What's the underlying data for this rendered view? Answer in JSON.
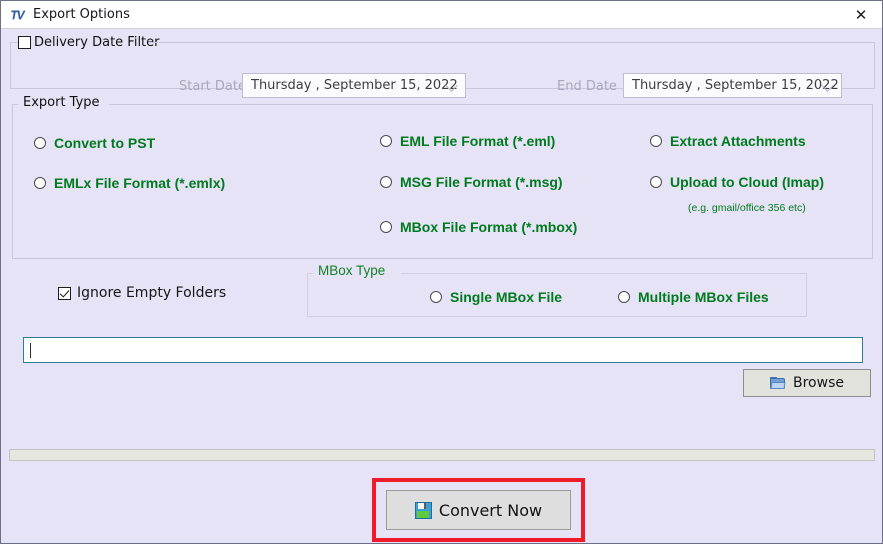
{
  "window": {
    "title": "Export Options",
    "app_icon": "tv-logo-icon",
    "close_label": "✕"
  },
  "delivery_filter": {
    "label": "Delivery Date Filter",
    "checked": false,
    "start": {
      "label": "Start Date",
      "value": "Thursday  , September 15, 2022"
    },
    "end": {
      "label": "End Date",
      "value": "Thursday  , September 15, 2022"
    }
  },
  "export_type": {
    "legend": "Export Type",
    "options": [
      {
        "label": "Convert to PST",
        "selected": false
      },
      {
        "label": "EMLx File  Format (*.emlx)",
        "selected": false
      },
      {
        "label": "EML File  Format (*.eml)",
        "selected": false
      },
      {
        "label": "MSG File Format (*.msg)",
        "selected": false
      },
      {
        "label": "MBox File Format (*.mbox)",
        "selected": false
      },
      {
        "label": "Extract Attachments",
        "selected": false
      },
      {
        "label": "Upload to Cloud (Imap)",
        "selected": false
      }
    ],
    "cloud_hint": "(e.g. gmail/office 356 etc)"
  },
  "options_band": {
    "ignore_empty_folders": {
      "label": "Ignore Empty Folders",
      "checked": true
    },
    "mbox_type": {
      "legend": "MBox Type",
      "options": [
        {
          "label": "Single MBox File",
          "selected": false
        },
        {
          "label": "Multiple MBox Files",
          "selected": false
        }
      ]
    }
  },
  "destination": {
    "path_value": "",
    "path_placeholder": "",
    "browse_label": "Browse",
    "browse_icon": "folder-icon"
  },
  "actions": {
    "convert_label": "Convert Now",
    "convert_icon": "save-icon"
  },
  "colors": {
    "window_background": "#e5e3f5",
    "green_text": "#007a1f",
    "highlight_red": "#ef1b2a",
    "input_border": "#2d7f94"
  }
}
